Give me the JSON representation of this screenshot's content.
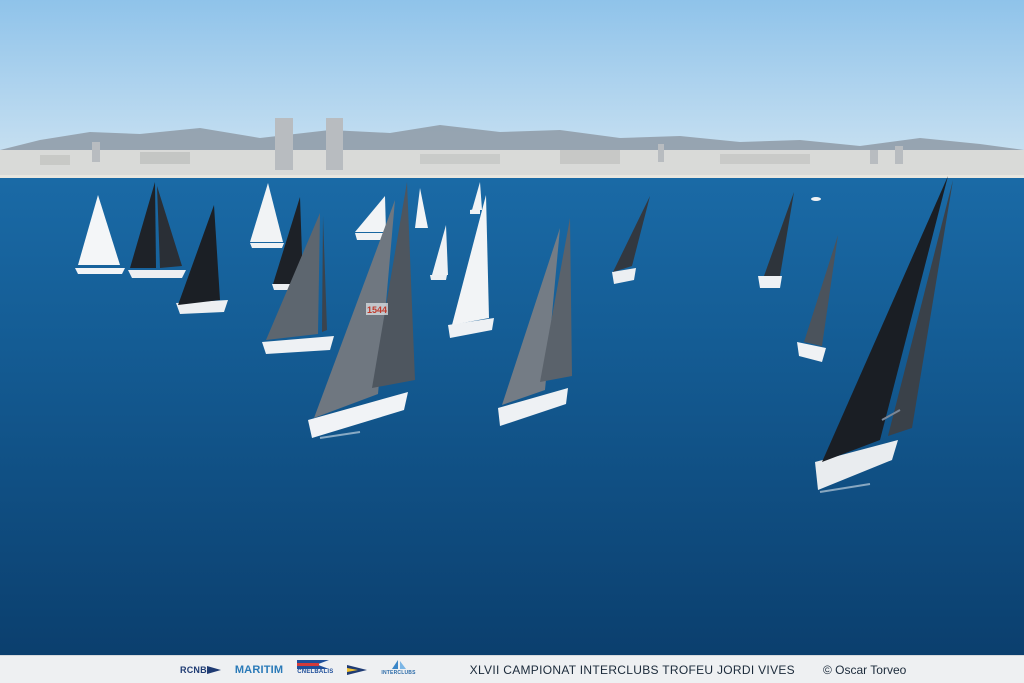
{
  "logos": {
    "rcnb": "RCNB",
    "maritim": "MARITIM",
    "cn_el_balis": "CNELBALIS",
    "interclubs": "INTERCLUBS"
  },
  "footer": {
    "event_title": "XLVII CAMPIONAT INTERCLUBS  TROFEU JORDI VIVES",
    "photo_credit": "© Oscar Torveo"
  },
  "sail_numbers": [
    "1544"
  ],
  "colors": {
    "sky_top": "#9fcbe8",
    "sea": "#0f5288",
    "footer_bg": "#eef0f2",
    "text": "#1b2a3a"
  }
}
